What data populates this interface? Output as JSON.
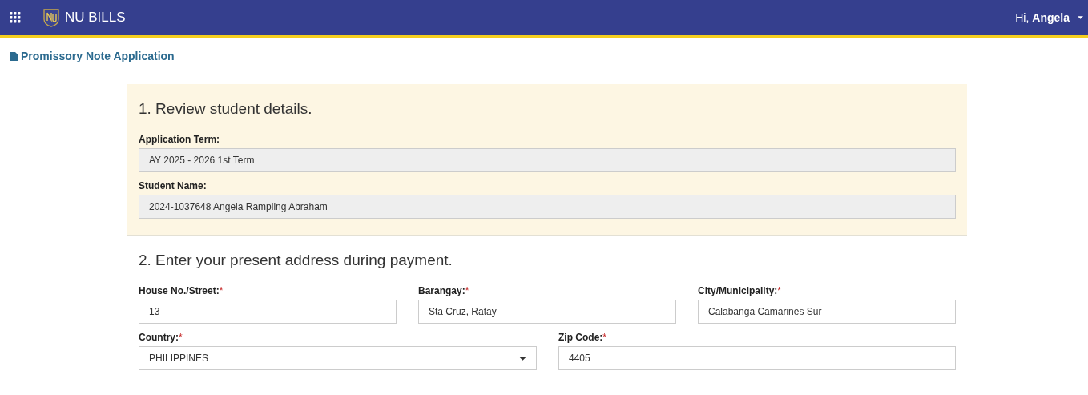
{
  "header": {
    "app_name": "NU BILLS",
    "greeting": "Hi,",
    "user_name": "Angela"
  },
  "page_title": "Promissory Note Application",
  "sections": [
    {
      "heading": "1. Review student details.",
      "highlighted": true,
      "rows": [
        [
          {
            "kind": "text",
            "label": "Application Term:",
            "value": "AY 2025 - 2026 1st Term",
            "disabled": true
          }
        ],
        [
          {
            "kind": "text",
            "label": "Student Name:",
            "value": "2024-1037648 Angela Rampling Abraham",
            "disabled": true
          }
        ]
      ]
    },
    {
      "heading": "2. Enter your present address during payment.",
      "highlighted": false,
      "rows": [
        [
          {
            "kind": "text",
            "label": "House No./Street:",
            "required_mark": "*",
            "value": "13",
            "disabled": false
          },
          {
            "kind": "text",
            "label": "Barangay:",
            "required_mark": "*",
            "value": "Sta Cruz, Ratay",
            "disabled": false
          },
          {
            "kind": "text",
            "label": "City/Municipality:",
            "required_mark": "*",
            "value": "Calabanga Camarines Sur",
            "disabled": false
          }
        ],
        [
          {
            "kind": "select",
            "label": "Country:",
            "required_mark": "*",
            "value": "PHILIPPINES",
            "disabled": false
          },
          {
            "kind": "text",
            "label": "Zip Code:",
            "required_mark": "*",
            "value": "4405",
            "disabled": false
          }
        ]
      ]
    }
  ]
}
